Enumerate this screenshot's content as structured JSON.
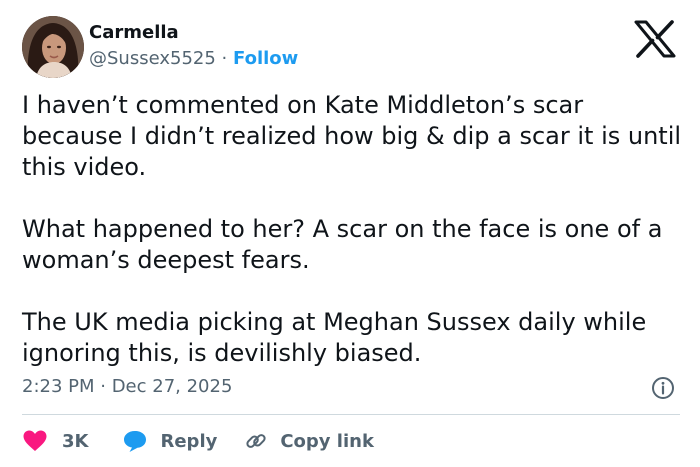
{
  "author": {
    "name": "Carmella",
    "handle": "@Sussex5525",
    "separator": "·",
    "follow_label": "Follow"
  },
  "tweet": {
    "paragraphs": [
      "I haven’t commented on Kate Middleton’s scar because I didn’t realized how big & dip a scar it is until this video.",
      "What happened to her? A scar on the face is one of a woman’s deepest fears.",
      "The UK media picking at Meghan Sussex daily while ignoring this, is devilishly biased."
    ],
    "timestamp": "2:23 PM · Dec 27, 2025"
  },
  "actions": {
    "like_count": "3K",
    "reply_label": "Reply",
    "copy_link_label": "Copy link"
  },
  "icons": {
    "logo": "x-logo-icon",
    "info": "info-icon",
    "like": "heart-icon",
    "reply": "reply-bubble-icon",
    "copy": "link-icon"
  },
  "colors": {
    "follow": "#1d9bf0",
    "heart": "#f91880",
    "reply_bubble": "#1d9bf0",
    "secondary_text": "#536471",
    "primary_text": "#0f1419"
  }
}
